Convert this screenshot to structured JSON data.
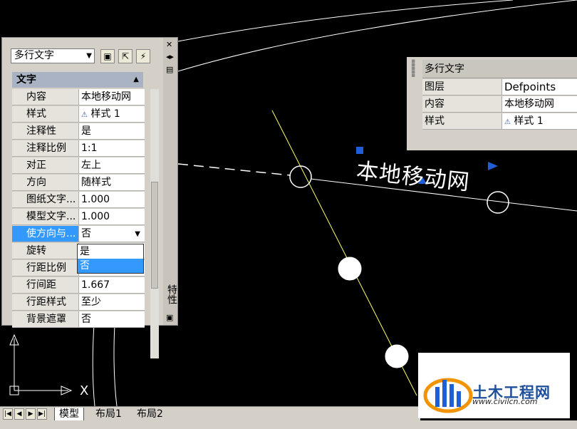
{
  "canvas": {
    "mtext_content": "本地移动网",
    "axis_label_x": "X"
  },
  "palette": {
    "object_type": "多行文字",
    "category": "文字",
    "rows": [
      {
        "name": "内容",
        "value": "本地移动网"
      },
      {
        "name": "样式",
        "value": "样式 1"
      },
      {
        "name": "注释性",
        "value": "是"
      },
      {
        "name": "注释比例",
        "value": "1:1"
      },
      {
        "name": "对正",
        "value": "左上"
      },
      {
        "name": "方向",
        "value": "随样式"
      },
      {
        "name": "图纸文字...",
        "value": "1.000"
      },
      {
        "name": "模型文字...",
        "value": "1.000"
      },
      {
        "name": "使方向与...",
        "value": "否"
      },
      {
        "name": "旋转",
        "value": ""
      },
      {
        "name": "行距比例",
        "value": ""
      },
      {
        "name": "行间距",
        "value": "1.667"
      },
      {
        "name": "行距样式",
        "value": "至少"
      },
      {
        "name": "背景遮罩",
        "value": "否"
      }
    ],
    "dropdown_options": [
      "是",
      "否"
    ],
    "dropdown_selected": "否",
    "side_label": "特性"
  },
  "quick": {
    "title": "多行文字",
    "rows": [
      {
        "name": "图层",
        "value": "Defpoints"
      },
      {
        "name": "内容",
        "value": "本地移动网"
      },
      {
        "name": "样式",
        "value": "样式 1"
      }
    ]
  },
  "tabs": [
    "模型",
    "布局1",
    "布局2"
  ],
  "active_tab": "模型",
  "logo": {
    "brand": "土木工程网",
    "url": "www.civilcn.com"
  },
  "colors": {
    "background": "#000000",
    "selection": "#3399ff",
    "grip": "#1e5ed6",
    "arrow": "#e02020",
    "highlight_line": "#ffff66"
  },
  "icons": [
    "style-icon",
    "select-objects-icon",
    "quick-select-icon",
    "toggle-pickadd-icon",
    "close-icon",
    "autohide-icon",
    "menu-icon"
  ]
}
